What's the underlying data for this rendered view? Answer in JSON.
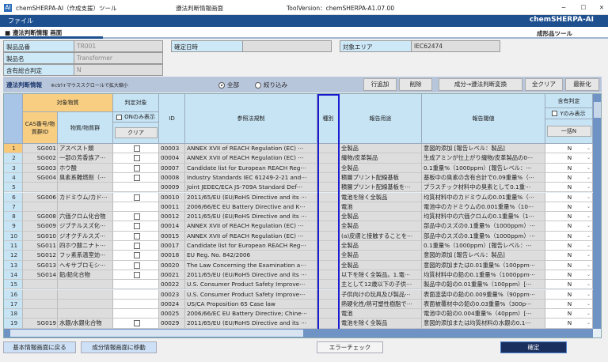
{
  "window": {
    "app_title": "chemSHERPA-AI（作成支援）ツール",
    "screen_name": "遵法判断情報画面",
    "version": "ToolVersion：chemSHERPA-A1.07.00",
    "icon": "AI",
    "min": "−",
    "max": "☐",
    "close": "✕"
  },
  "menu": {
    "file": "ファイル",
    "logo": "chemSHERPA-AI"
  },
  "screen": {
    "title": "■ 遵法判断情報 画面",
    "subtitle": "成形品ツール"
  },
  "info": {
    "product_no_label": "製品品番",
    "product_no": "TR001",
    "product_name_label": "製品名",
    "product_name": "Transformer",
    "total_judgment_label": "含有総合判定",
    "total_judgment": "N",
    "confirm_date_label": "確定日時",
    "confirm_date": "",
    "target_area_label": "対象エリア",
    "target_area": "IEC62474"
  },
  "toolbar": {
    "title": "遵法判断情報",
    "hint": "※ctrl+マウススクロールで拡大縮小",
    "radio_all": "全部",
    "radio_filter": "絞り込み",
    "add_row": "行追加",
    "delete": "削除",
    "convert": "成分→遵法判断変換",
    "clear_all": "全クリア",
    "refresh": "最新化"
  },
  "headers": {
    "target_substance": "対象物質",
    "cas": "CAS番号/物質群ID",
    "substance": "物質/物質群",
    "judge_target": "判定対象",
    "on_only": "ONのみ表示",
    "clear": "クリア",
    "id": "ID",
    "ref_law": "参照法規制",
    "type": "種別",
    "report_use": "報告用途",
    "threshold": "報告閾値",
    "content_judgment": "含有判定",
    "y_only": "Yのみ表示",
    "bulk_n": "一括N"
  },
  "rows": [
    [
      "1",
      "SG001",
      "アスベスト類",
      true,
      "00003",
      "ANNEX XVII of REACH Regulation (EC) ⋯",
      "全製品",
      "意図的添加 [報告レベル：製品]",
      "N"
    ],
    [
      "2",
      "SG002",
      "一部の芳香族ア⋯",
      true,
      "00004",
      "ANNEX XVII of REACH Regulation (EC) ⋯",
      "織物/皮革製品",
      "生成アミンが仕上がり織物/皮革製品の0⋯",
      "N"
    ],
    [
      "3",
      "SG003",
      "ホウ酸",
      true,
      "00007",
      "Candidate list for European REACH Reg⋯",
      "全製品",
      "0.1重量%（1000ppm）[報告レベル：⋯",
      "N"
    ],
    [
      "4",
      "SG004",
      "臭素系難燃剤（⋯",
      true,
      "00008",
      "Industry Standards IEC 61249-2-21 and⋯",
      "積層プリント配線基板",
      "基板中の臭素の含有合計で0.09重量%（⋯",
      "N"
    ],
    [
      "5",
      "",
      "",
      null,
      "00009",
      "Joint JEDEC/ECA JS-709A Standard Def⋯",
      "積層プリント配線基板を⋯",
      "プラスチック材料中の臭素として0.1重⋯",
      "N"
    ],
    [
      "6",
      "SG006",
      "カドミウム/カド⋯",
      true,
      "00010",
      "2011/65/EU (EU/RoHS Directive and its ⋯",
      "電池を除く全製品",
      "均質材料中のカドミウムの0.01重量%（⋯",
      "N"
    ],
    [
      "7",
      "",
      "",
      null,
      "00011",
      "2006/66/EC EU Battery Directive and K⋯",
      "電池",
      "電池中のカドミウムの0.001重量%（10⋯",
      "N"
    ],
    [
      "8",
      "SG008",
      "六価クロム化合物",
      true,
      "00012",
      "2011/65/EU (EU/RoHS Directive and its ⋯",
      "全製品",
      "均質材料中の六価クロムの0.1重量%（1⋯",
      "N"
    ],
    [
      "9",
      "SG009",
      "ジブチルスズ化⋯",
      true,
      "00014",
      "ANNEX XVII of REACH Regulation (EC) ⋯",
      "全製品",
      "部品中のスズの0.1重量%（1000ppm）⋯",
      "N"
    ],
    [
      "10",
      "SG010",
      "ジオクチルスズ⋯",
      true,
      "00015",
      "ANNEX XVII of REACH Regulation (EC) ⋯",
      "(a)皮膚と接触することを⋯",
      "部品中のスズの0.1重量%（1000ppm）⋯",
      "N"
    ],
    [
      "11",
      "SG011",
      "四ホウ酸ニナト⋯",
      true,
      "00017",
      "Candidate list for European REACH Reg⋯",
      "全製品",
      "0.1重量%（1000ppm）[報告レベル：⋯",
      "N"
    ],
    [
      "12",
      "SG012",
      "フッ素系温室効⋯",
      true,
      "00018",
      "EU Reg. No. 842/2006",
      "全製品",
      "意図的添加 [報告レベル：製品]",
      "N"
    ],
    [
      "13",
      "SG013",
      "ヘキサブロモシ⋯",
      true,
      "00020",
      "The Law Concerning the Examination a⋯",
      "全製品",
      "意図的添加または0.01重量%（100ppm⋯",
      "N"
    ],
    [
      "14",
      "SG014",
      "鉛/鉛化合物",
      true,
      "00021",
      "2011/65/EU (EU/RoHS Directive and its ⋯",
      "以下を除く全製品。1.電⋯",
      "均質材料中の鉛の0.1重量%（1000ppm⋯",
      "N"
    ],
    [
      "15",
      "",
      "",
      null,
      "00022",
      "U.S. Consumer Product Safety Improve⋯",
      "主として12歳以下の子供⋯",
      "製品中の鉛の0.01重量%（100ppm）[⋯",
      "N"
    ],
    [
      "16",
      "",
      "",
      null,
      "00023",
      "U.S. Consumer Product Safety Improve⋯",
      "子供向けの玩具及び製品⋯",
      "表面塗装中の鉛の0.009重量%（90ppm⋯",
      "N"
    ],
    [
      "17",
      "",
      "",
      null,
      "00024",
      "US/CA Proposition 65 Case law",
      "熱硬化性/熱可塑性樹脂で⋯",
      "表面被覆材中の鉛の0.03重量%（300p⋯",
      "N"
    ],
    [
      "18",
      "",
      "",
      null,
      "00025",
      "2006/66/EC EU Battery Directive; Chine⋯",
      "電池",
      "電池中の鉛の0.004重量%（40ppm）[⋯",
      "N"
    ],
    [
      "19",
      "SG019",
      "水銀/水銀化合物",
      true,
      "00029",
      "2011/65/EU (EU/RoHS Directive and its ⋯",
      "電池を除く全製品",
      "意図的添加または均質材料の水銀の0.1⋯",
      "N"
    ]
  ],
  "footer": {
    "back": "基本情報画面に戻る",
    "to_component": "成分情報画面に移動",
    "error_check": "エラーチェック",
    "confirm": "確定"
  }
}
